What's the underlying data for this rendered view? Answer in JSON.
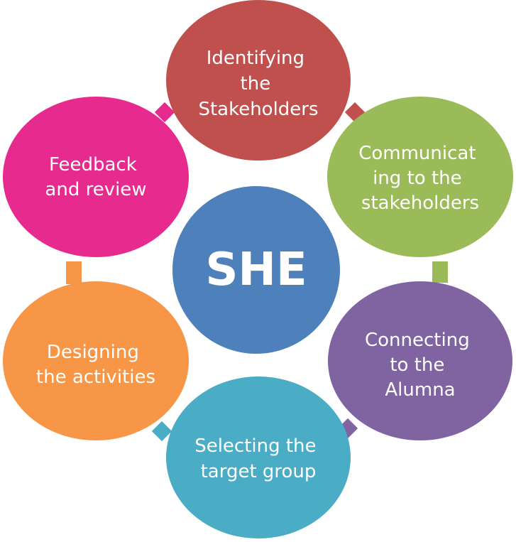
{
  "center": {
    "label": "SHE",
    "color": "#4E80BC"
  },
  "steps": [
    {
      "lines": [
        "Identifying",
        "the",
        "Stakeholders"
      ],
      "color": "#C0504D"
    },
    {
      "lines": [
        "Communicat",
        "ing to the",
        "stakeholders"
      ],
      "color": "#9BBB59"
    },
    {
      "lines": [
        "Connecting",
        "to the",
        "Alumna"
      ],
      "color": "#8064A2"
    },
    {
      "lines": [
        "Selecting the",
        "target group"
      ],
      "color": "#4BACC6"
    },
    {
      "lines": [
        "Designing",
        "the activities"
      ],
      "color": "#F79646"
    },
    {
      "lines": [
        "Feedback",
        "and review"
      ],
      "color": "#E62A8E"
    }
  ]
}
